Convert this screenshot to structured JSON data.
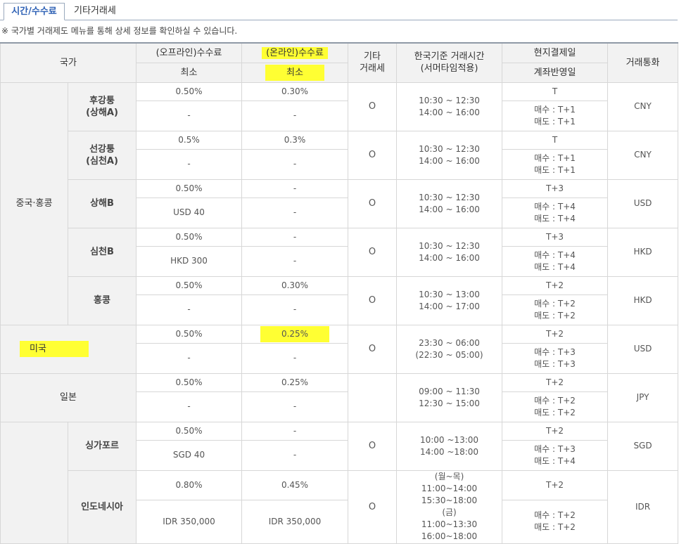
{
  "tabs": [
    {
      "label": "시간/수수료",
      "active": true
    },
    {
      "label": "기타거래세",
      "active": false
    }
  ],
  "notice": "※ 국가별 거래제도 메뉴를 통해 상세 정보를 확인하실 수 있습니다.",
  "header": {
    "country": "국가",
    "offline_fee": "(오프라인)수수료",
    "online_fee": "(온라인)수수료",
    "min": "최소",
    "other_tax": "기타\n거래세",
    "trading_hours": "한국기준 거래시간\n(서머타임적용)",
    "local_settlement": "현지결제일",
    "account_reflection": "계좌반영일",
    "currency": "거래통화"
  },
  "groups": {
    "china_hk": "중국·홍콩",
    "us": "미국",
    "japan": "일본"
  },
  "rows": [
    {
      "name": "후강퉁\n(상해A)",
      "off_rate": "0.50%",
      "off_min": "-",
      "on_rate": "0.30%",
      "on_min": "-",
      "tax": "O",
      "hours": "10:30 ~ 12:30\n14:00 ~ 16:00",
      "settle": "T",
      "reflect": "매수 : T+1\n매도 : T+1",
      "currency": "CNY"
    },
    {
      "name": "선강퉁\n(심천A)",
      "off_rate": "0.5%",
      "off_min": "-",
      "on_rate": "0.3%",
      "on_min": "-",
      "tax": "O",
      "hours": "10:30 ~ 12:30\n14:00 ~ 16:00",
      "settle": "T",
      "reflect": "매수 : T+1\n매도 : T+1",
      "currency": "CNY"
    },
    {
      "name": "상해B",
      "off_rate": "0.50%",
      "off_min": "USD 40",
      "on_rate": "-",
      "on_min": "-",
      "tax": "O",
      "hours": "10:30 ~ 12:30\n14:00 ~ 16:00",
      "settle": "T+3",
      "reflect": "매수 : T+4\n매도 : T+4",
      "currency": "USD"
    },
    {
      "name": "심천B",
      "off_rate": "0.50%",
      "off_min": "HKD 300",
      "on_rate": "-",
      "on_min": "-",
      "tax": "O",
      "hours": "10:30 ~ 12:30\n14:00 ~ 16:00",
      "settle": "T+3",
      "reflect": "매수 : T+4\n매도 : T+4",
      "currency": "HKD"
    },
    {
      "name": "홍콩",
      "off_rate": "0.50%",
      "off_min": "-",
      "on_rate": "0.30%",
      "on_min": "-",
      "tax": "O",
      "hours": "10:30 ~ 13:00\n14:00 ~ 17:00",
      "settle": "T+2",
      "reflect": "매수 : T+2\n매도 : T+2",
      "currency": "HKD"
    },
    {
      "name": "미국",
      "off_rate": "0.50%",
      "off_min": "-",
      "on_rate": "0.25%",
      "on_min": "-",
      "tax": "O",
      "hours": "23:30 ~ 06:00\n(22:30 ~ 05:00)",
      "settle": "T+2",
      "reflect": "매수 : T+3\n매도 : T+3",
      "currency": "USD"
    },
    {
      "name": "일본",
      "off_rate": "0.50%",
      "off_min": "-",
      "on_rate": "0.25%",
      "on_min": "-",
      "tax": "",
      "hours": "09:00 ~ 11:30\n12:30 ~ 15:00",
      "settle": "T+2",
      "reflect": "매수 : T+2\n매도 : T+2",
      "currency": "JPY"
    },
    {
      "name": "싱가포르",
      "off_rate": "0.50%",
      "off_min": "SGD 40",
      "on_rate": "-",
      "on_min": "-",
      "tax": "O",
      "hours": "10:00 ~13:00\n14:00 ~18:00",
      "settle": "T+2",
      "reflect": "매수 : T+3\n매도 : T+4",
      "currency": "SGD"
    },
    {
      "name": "인도네시아",
      "off_rate": "0.80%",
      "off_min": "IDR 350,000",
      "on_rate": "0.45%",
      "on_min": "IDR 350,000",
      "tax": "O",
      "hours": "(월~목)\n11:00~14:00\n15:30~18:00\n(금)\n11:00~13:30\n16:00~18:00",
      "settle": "T+2",
      "reflect": "매수 : T+2\n매도 : T+2",
      "currency": "IDR"
    }
  ],
  "colors": {
    "highlight": "#ffff33",
    "tab_active": "#2e61b5",
    "header_bg": "#f2f2f2",
    "border": "#d7d7d7"
  }
}
